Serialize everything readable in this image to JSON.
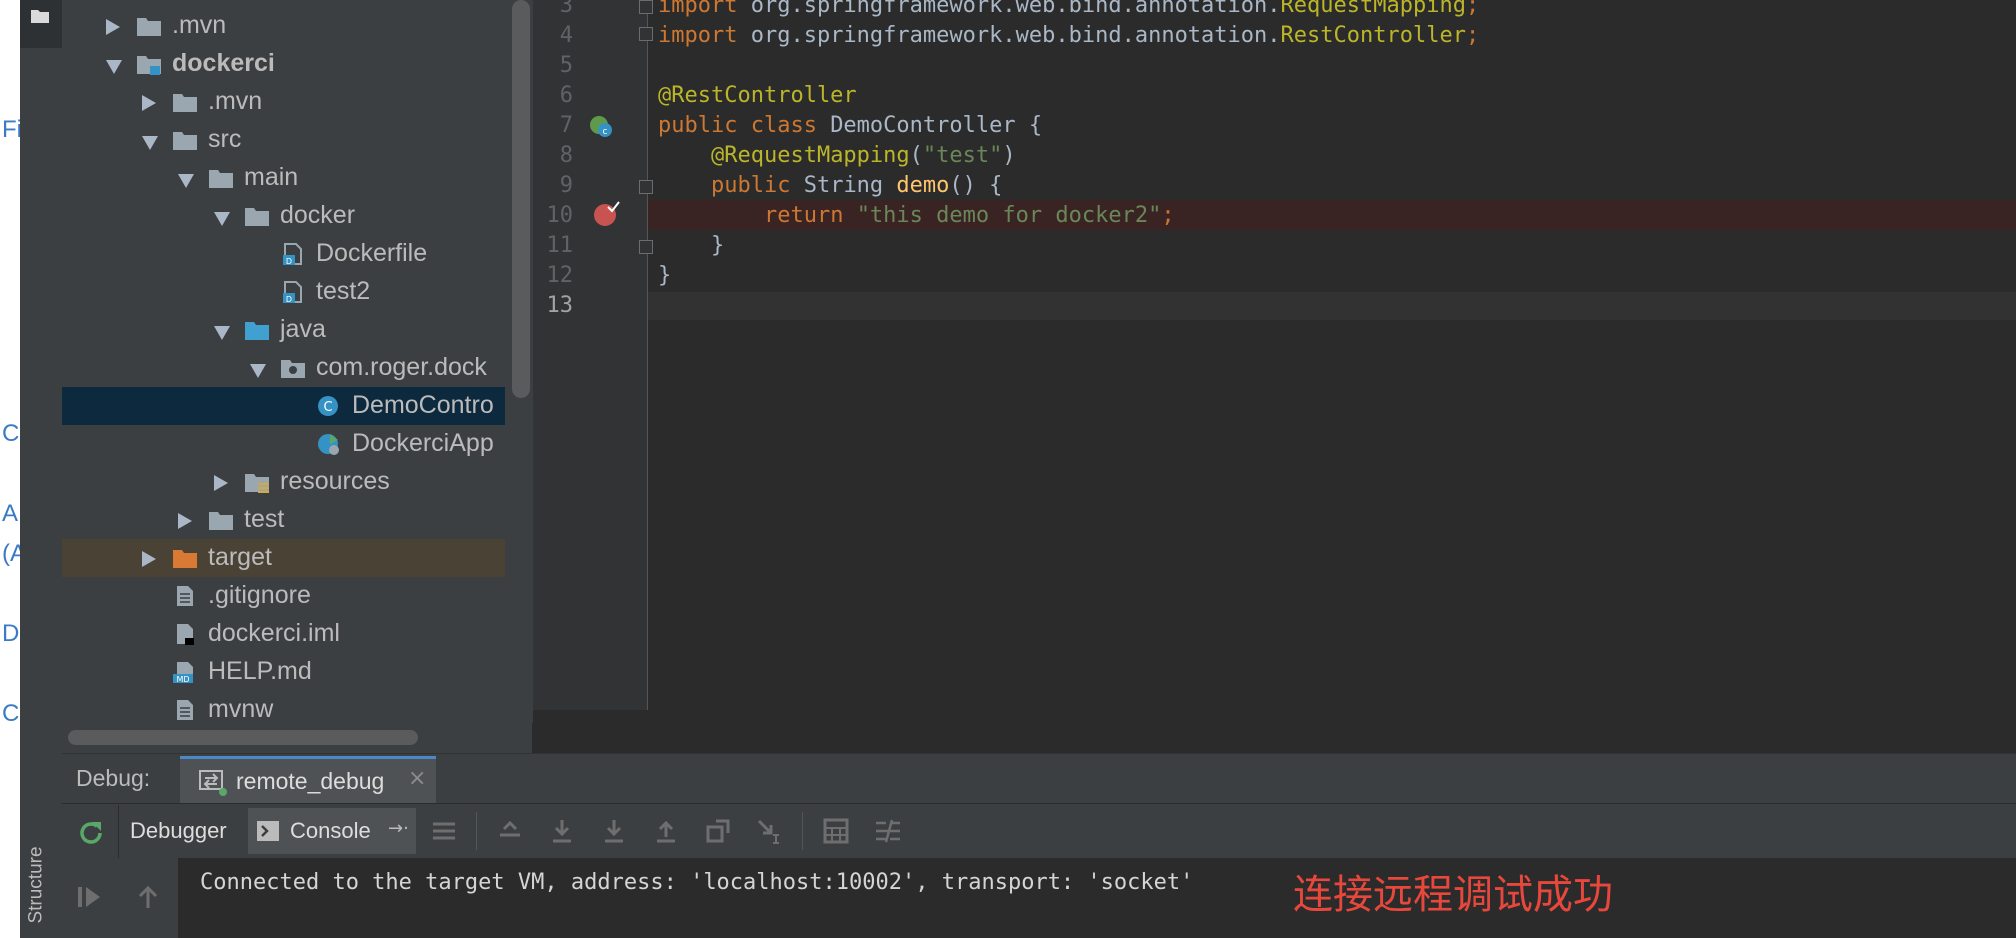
{
  "left_strip": {
    "fragments": [
      "Fi",
      "C",
      "A",
      "(A",
      "D",
      "C"
    ]
  },
  "tool_stripe": {
    "structure_label": "Structure"
  },
  "project_tree": {
    "items": [
      {
        "label": ".mvn",
        "indent": 0,
        "state": "collapsed",
        "icon": "folder-icon"
      },
      {
        "label": "dockerci",
        "indent": 0,
        "state": "expanded",
        "icon": "module-folder-icon",
        "bold": true
      },
      {
        "label": ".mvn",
        "indent": 1,
        "state": "collapsed",
        "icon": "folder-icon"
      },
      {
        "label": "src",
        "indent": 1,
        "state": "expanded",
        "icon": "folder-icon"
      },
      {
        "label": "main",
        "indent": 2,
        "state": "expanded",
        "icon": "folder-icon"
      },
      {
        "label": "docker",
        "indent": 3,
        "state": "expanded",
        "icon": "folder-icon"
      },
      {
        "label": "Dockerfile",
        "indent": 4,
        "state": "leaf",
        "icon": "dockerfile-icon"
      },
      {
        "label": "test2",
        "indent": 4,
        "state": "leaf",
        "icon": "dockerfile-icon"
      },
      {
        "label": "java",
        "indent": 3,
        "state": "expanded",
        "icon": "source-folder-icon"
      },
      {
        "label": "com.roger.dock",
        "indent": 4,
        "state": "expanded",
        "icon": "package-icon"
      },
      {
        "label": "DemoContro",
        "indent": 5,
        "state": "leaf",
        "icon": "class-icon",
        "selected": true
      },
      {
        "label": "DockerciApp",
        "indent": 5,
        "state": "leaf",
        "icon": "spring-boot-class-icon"
      },
      {
        "label": "resources",
        "indent": 3,
        "state": "collapsed",
        "icon": "resources-folder-icon"
      },
      {
        "label": "test",
        "indent": 2,
        "state": "collapsed",
        "icon": "folder-icon"
      },
      {
        "label": "target",
        "indent": 1,
        "state": "collapsed",
        "icon": "excluded-folder-icon",
        "excluded": true
      },
      {
        "label": ".gitignore",
        "indent": 1,
        "state": "leaf",
        "icon": "text-file-icon"
      },
      {
        "label": "dockerci.iml",
        "indent": 1,
        "state": "leaf",
        "icon": "iml-file-icon"
      },
      {
        "label": "HELP.md",
        "indent": 1,
        "state": "leaf",
        "icon": "markdown-file-icon"
      },
      {
        "label": "mvnw",
        "indent": 1,
        "state": "leaf",
        "icon": "text-file-icon"
      }
    ]
  },
  "editor": {
    "lines": [
      {
        "n": "3",
        "tokens": [
          [
            "kw",
            "import "
          ],
          [
            "",
            "org.springframework.web.bind.annotation."
          ],
          [
            "ann",
            "RequestMapping"
          ],
          [
            "kw",
            ";"
          ]
        ]
      },
      {
        "n": "4",
        "tokens": [
          [
            "kw",
            "import "
          ],
          [
            "",
            "org.springframework.web.bind.annotation."
          ],
          [
            "ann",
            "RestController"
          ],
          [
            "kw",
            ";"
          ]
        ]
      },
      {
        "n": "5",
        "tokens": []
      },
      {
        "n": "6",
        "tokens": [
          [
            "ann",
            "@RestController"
          ]
        ]
      },
      {
        "n": "7",
        "tokens": [
          [
            "kw",
            "public class "
          ],
          [
            "",
            "DemoController {"
          ]
        ]
      },
      {
        "n": "8",
        "tokens": [
          [
            "",
            "    "
          ],
          [
            "ann",
            "@RequestMapping"
          ],
          [
            "",
            "("
          ],
          [
            "str",
            "\"test\""
          ],
          [
            "",
            ")"
          ]
        ]
      },
      {
        "n": "9",
        "tokens": [
          [
            "",
            "    "
          ],
          [
            "kw",
            "public "
          ],
          [
            "",
            "String "
          ],
          [
            "fn",
            "demo"
          ],
          [
            "",
            "() {"
          ]
        ]
      },
      {
        "n": "10",
        "tokens": [
          [
            "",
            "        "
          ],
          [
            "kw",
            "return "
          ],
          [
            "str",
            "\"this demo for docker2\""
          ],
          [
            "kw",
            ";"
          ]
        ]
      },
      {
        "n": "11",
        "tokens": [
          [
            "",
            "    }"
          ]
        ]
      },
      {
        "n": "12",
        "tokens": [
          [
            "",
            "}"
          ]
        ]
      },
      {
        "n": "13",
        "tokens": []
      }
    ]
  },
  "debug": {
    "label": "Debug:",
    "session_tab": "remote_debug",
    "tabs": {
      "debugger": "Debugger",
      "console": "Console"
    },
    "console_output": "Connected to the target VM, address: 'localhost:10002', transport: 'socket'",
    "annotation": "连接远程调试成功"
  },
  "colors": {
    "annotation": "#e8473c",
    "selection": "#0d293e",
    "excluded": "#4a4235",
    "breakpoint_line": "#3a2323"
  }
}
